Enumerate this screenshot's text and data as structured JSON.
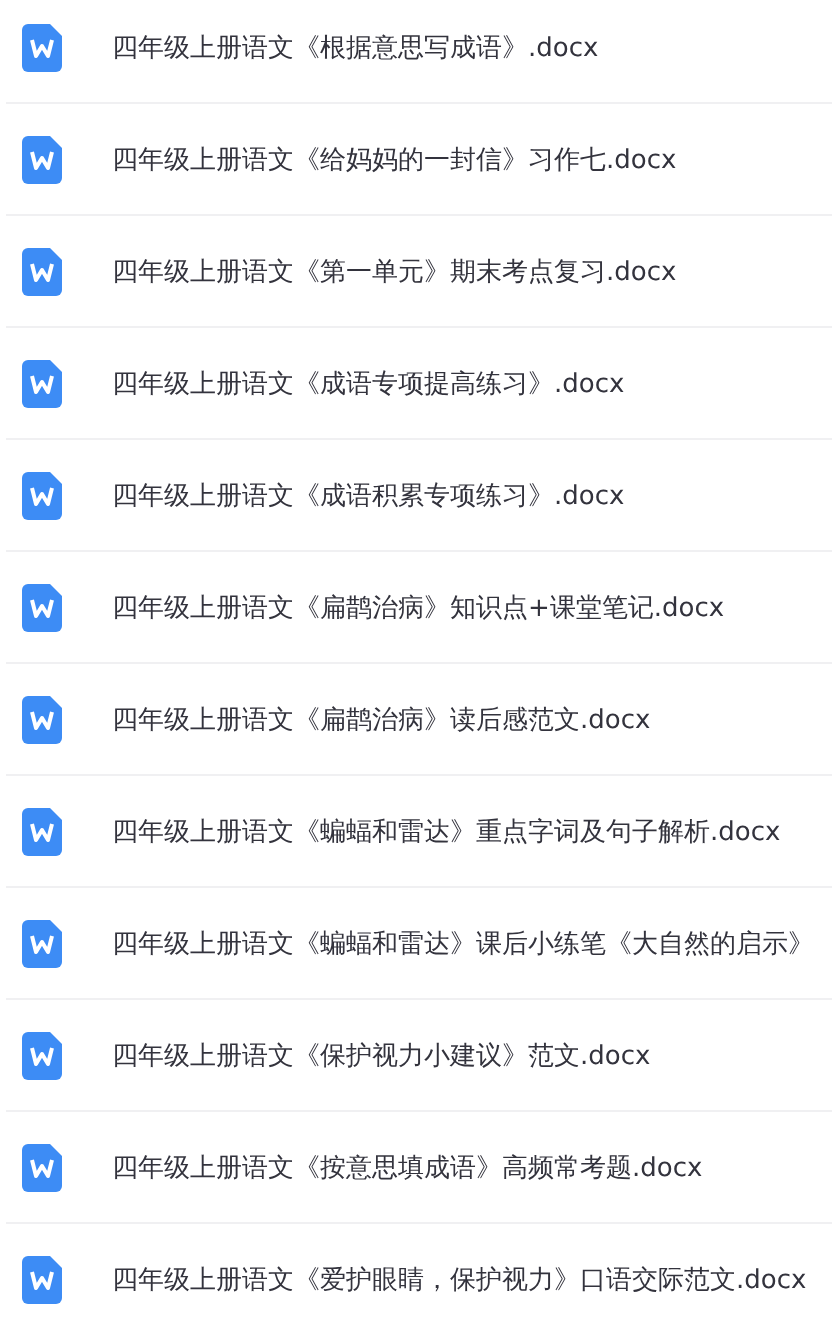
{
  "files": [
    {
      "name": "四年级上册语文《根据意思写成语》.docx"
    },
    {
      "name": "四年级上册语文《给妈妈的一封信》习作七.docx"
    },
    {
      "name": "四年级上册语文《第一单元》期末考点复习.docx"
    },
    {
      "name": "四年级上册语文《成语专项提高练习》.docx"
    },
    {
      "name": "四年级上册语文《成语积累专项练习》.docx"
    },
    {
      "name": "四年级上册语文《扁鹊治病》知识点+课堂笔记.docx"
    },
    {
      "name": "四年级上册语文《扁鹊治病》读后感范文.docx"
    },
    {
      "name": "四年级上册语文《蝙蝠和雷达》重点字词及句子解析.docx"
    },
    {
      "name": "四年级上册语文《蝙蝠和雷达》课后小练笔《大自然的启示》"
    },
    {
      "name": "四年级上册语文《保护视力小建议》范文.docx"
    },
    {
      "name": "四年级上册语文《按意思填成语》高频常考题.docx"
    },
    {
      "name": "四年级上册语文《爱护眼睛，保护视力》口语交际范文.docx"
    }
  ]
}
